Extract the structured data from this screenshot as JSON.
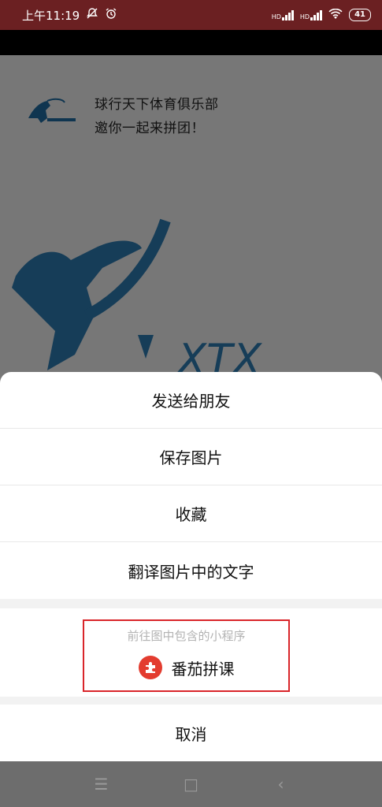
{
  "status": {
    "time": "上午11:19",
    "battery": "41",
    "signal1": "HD",
    "signal2": "HD"
  },
  "background": {
    "invite_line1": "球行天下体育俱乐部",
    "invite_line2": "邀你一起来拼团！",
    "logo_text": "XTX"
  },
  "sheet": {
    "items": [
      {
        "label": "发送给朋友"
      },
      {
        "label": "保存图片"
      },
      {
        "label": "收藏"
      },
      {
        "label": "翻译图片中的文字"
      }
    ],
    "mini_program": {
      "title": "前往图中包含的小程序",
      "name": "番茄拼课"
    },
    "cancel": "取消"
  },
  "nav": {
    "menu": "☰",
    "home": "□",
    "back": "‹"
  },
  "colors": {
    "status_bar": "#6b2022",
    "highlight_border": "#d9252a",
    "mini_icon": "#e33c2f"
  }
}
